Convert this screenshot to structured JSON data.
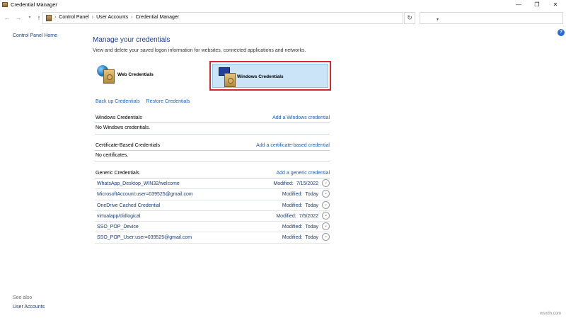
{
  "window": {
    "title": "Credential Manager",
    "min_glyph": "—",
    "max_glyph": "❐",
    "close_glyph": "✕"
  },
  "nav": {
    "back_glyph": "←",
    "forward_glyph": "→",
    "recent_glyph": "▾",
    "up_glyph": "↑",
    "breadcrumbs": [
      "Control Panel",
      "User Accounts",
      "Credential Manager"
    ],
    "separator": "›",
    "dropdown_glyph": "▾",
    "refresh_glyph": "↻",
    "search_placeholder": ""
  },
  "left_pane": {
    "home": "Control Panel Home",
    "see_also": "See also",
    "user_accounts": "User Accounts"
  },
  "help_glyph": "?",
  "main": {
    "heading": "Manage your credentials",
    "description": "View and delete your saved logon information for websites, connected applications and networks.",
    "tiles": {
      "web": "Web Credentials",
      "windows": "Windows Credentials"
    },
    "backup_link": "Back up Credentials",
    "restore_link": "Restore Credentials",
    "windows_section": {
      "title": "Windows Credentials",
      "add": "Add a Windows credential",
      "empty": "No Windows credentials."
    },
    "cert_section": {
      "title": "Certificate-Based Credentials",
      "add": "Add a certificate-based credential",
      "empty": "No certificates."
    },
    "generic_section": {
      "title": "Generic Credentials",
      "add": "Add a generic credential",
      "items": [
        {
          "name": "WhatsApp_Desktop_WIN32/welcome",
          "modified_label": "Modified:",
          "date": "7/15/2022"
        },
        {
          "name": "MicrosoftAccount:user=039525@gmail.com",
          "modified_label": "Modified:",
          "date": "Today"
        },
        {
          "name": "OneDrive Cached Credential",
          "modified_label": "Modified:",
          "date": "Today"
        },
        {
          "name": "virtualapp/didlogical",
          "modified_label": "Modified:",
          "date": "7/5/2022"
        },
        {
          "name": "SSO_POP_Device",
          "modified_label": "Modified:",
          "date": "Today"
        },
        {
          "name": "SSO_POP_User:user=039525@gmail.com",
          "modified_label": "Modified:",
          "date": "Today"
        }
      ]
    }
  },
  "chevron_glyph": "⌄",
  "watermark": "wsxdn.com",
  "colors": {
    "highlight_border": "#d9252a",
    "selected_tile": "#cce4f7",
    "link": "#1a5fb4",
    "heading": "#1e3e8c"
  }
}
